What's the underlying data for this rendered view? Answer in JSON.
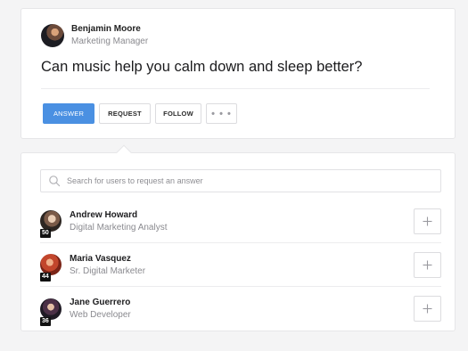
{
  "question": {
    "author": {
      "name": "Benjamin Moore",
      "role": "Marketing Manager"
    },
    "title": "Can music help you calm down and sleep better?",
    "actions": {
      "answer_label": "ANSWER",
      "request_label": "REQUEST",
      "follow_label": "FOLLOW",
      "more_label": "• • •"
    }
  },
  "request_panel": {
    "search": {
      "placeholder": "Search for users to request an answer",
      "value": ""
    },
    "users": [
      {
        "name": "Andrew Howard",
        "role": "Digital Marketing Analyst",
        "level": "50"
      },
      {
        "name": "Maria Vasquez",
        "role": "Sr. Digital Marketer",
        "level": "44"
      },
      {
        "name": "Jane Guerrero",
        "role": "Web Developer",
        "level": "36"
      }
    ]
  },
  "colors": {
    "accent": "#4a90e2",
    "border": "#e6e6e8",
    "muted_text": "#8a8a8f"
  },
  "icons": {
    "search": "search-icon",
    "add": "plus-icon"
  }
}
